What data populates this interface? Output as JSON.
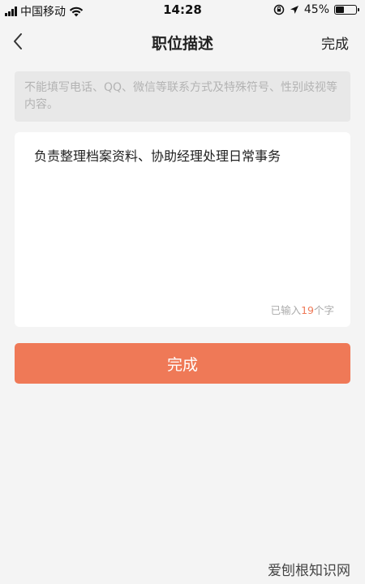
{
  "status_bar": {
    "carrier": "中国移动",
    "time": "14:28",
    "battery_percent": "45%",
    "battery_level": 0.45
  },
  "nav": {
    "title": "职位描述",
    "done_label": "完成",
    "back_icon": "chevron-left-icon"
  },
  "notice": {
    "text": "不能填写电话、QQ、微信等联系方式及特殊符号、性别歧视等内容。"
  },
  "editor": {
    "value": "负责整理档案资料、协助经理处理日常事务",
    "counter_prefix": "已输入",
    "counter_count": "19",
    "counter_suffix": "个字"
  },
  "submit": {
    "label": "完成"
  },
  "watermark": {
    "text": "爱刨根知识网"
  },
  "colors": {
    "accent": "#ef7957",
    "background": "#f4f4f4"
  }
}
